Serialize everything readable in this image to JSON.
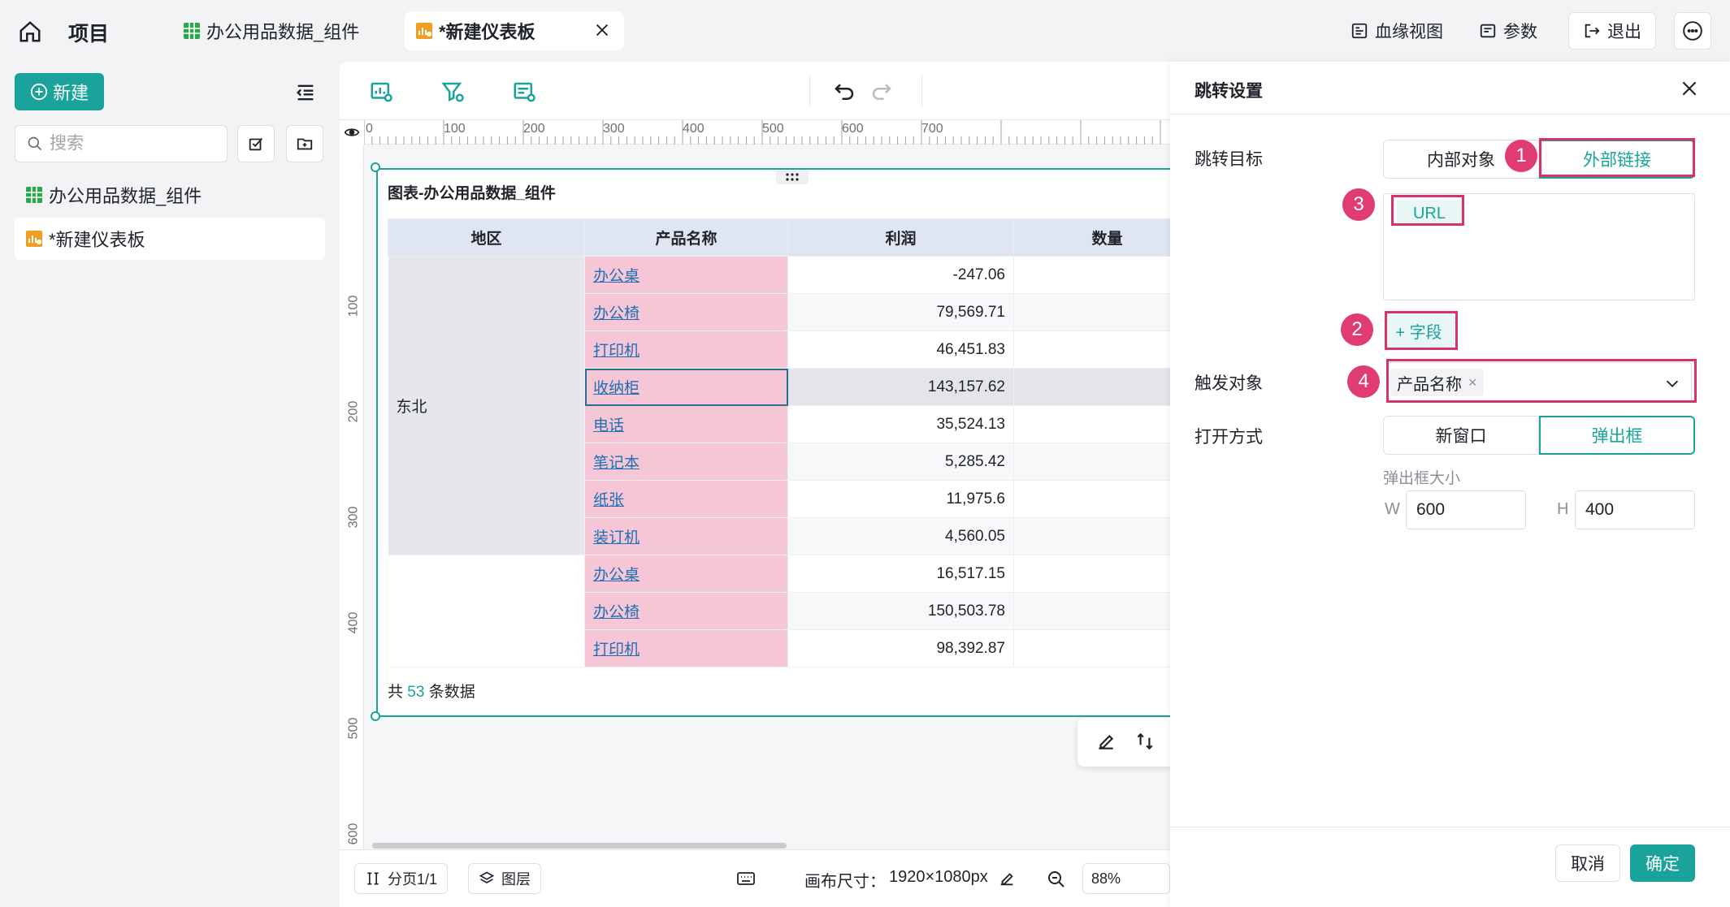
{
  "topbar": {
    "project_title": "项目",
    "tabs": [
      {
        "label": "办公用品数据_组件",
        "icon": "table-icon"
      },
      {
        "label": "*新建仪表板",
        "icon": "dashboard-icon"
      }
    ],
    "lineage_label": "血缘视图",
    "params_label": "参数",
    "exit_label": "退出"
  },
  "sidebar": {
    "new_label": "新建",
    "search_placeholder": "搜索",
    "items": [
      {
        "label": "办公用品数据_组件",
        "icon": "table-icon"
      },
      {
        "label": "*新建仪表板",
        "icon": "dashboard-icon"
      }
    ]
  },
  "canvas": {
    "ruler_top": [
      "0",
      "100",
      "200",
      "300",
      "400",
      "500",
      "600",
      "700"
    ],
    "ruler_left": [
      "100",
      "200",
      "300",
      "400",
      "500",
      "600"
    ],
    "widget": {
      "title": "图表-办公用品数据_组件",
      "columns": [
        "地区",
        "产品名称",
        "利润",
        "数量"
      ],
      "region_1": "东北",
      "rows": [
        {
          "product": "办公桌",
          "profit": "-247.06"
        },
        {
          "product": "办公椅",
          "profit": "79,569.71"
        },
        {
          "product": "打印机",
          "profit": "46,451.83"
        },
        {
          "product": "收纳柜",
          "profit": "143,157.62"
        },
        {
          "product": "电话",
          "profit": "35,524.13"
        },
        {
          "product": "笔记本",
          "profit": "5,285.42"
        },
        {
          "product": "纸张",
          "profit": "11,975.6"
        },
        {
          "product": "装订机",
          "profit": "4,560.05"
        },
        {
          "product": "办公桌",
          "profit": "16,517.15"
        },
        {
          "product": "办公椅",
          "profit": "150,503.78"
        },
        {
          "product": "打印机",
          "profit": "98,392.87"
        }
      ],
      "footer_prefix": "共",
      "footer_count": "53",
      "footer_suffix": "条数据"
    },
    "bottom": {
      "page_label": "分页1/1",
      "layer_label": "图层",
      "canvas_size_label": "画布尺寸：",
      "canvas_size_value": "1920×1080px",
      "zoom": "88%"
    }
  },
  "panel": {
    "title": "跳转设置",
    "target_label": "跳转目标",
    "target_options": [
      "内部对象",
      "外部链接"
    ],
    "url_chip": "URL",
    "field_button": "+ 字段",
    "trigger_label": "触发对象",
    "trigger_tag": "产品名称",
    "open_label": "打开方式",
    "open_options": [
      "新窗口",
      "弹出框"
    ],
    "popup_size_label": "弹出框大小",
    "w_label": "W",
    "w_value": "600",
    "h_label": "H",
    "h_value": "400",
    "cancel_label": "取消",
    "ok_label": "确定"
  },
  "annotations": [
    "1",
    "2",
    "3",
    "4"
  ],
  "colors": {
    "accent": "#1aa39a",
    "annotation": "#e03c72",
    "highlight": "#f5c6d5"
  }
}
